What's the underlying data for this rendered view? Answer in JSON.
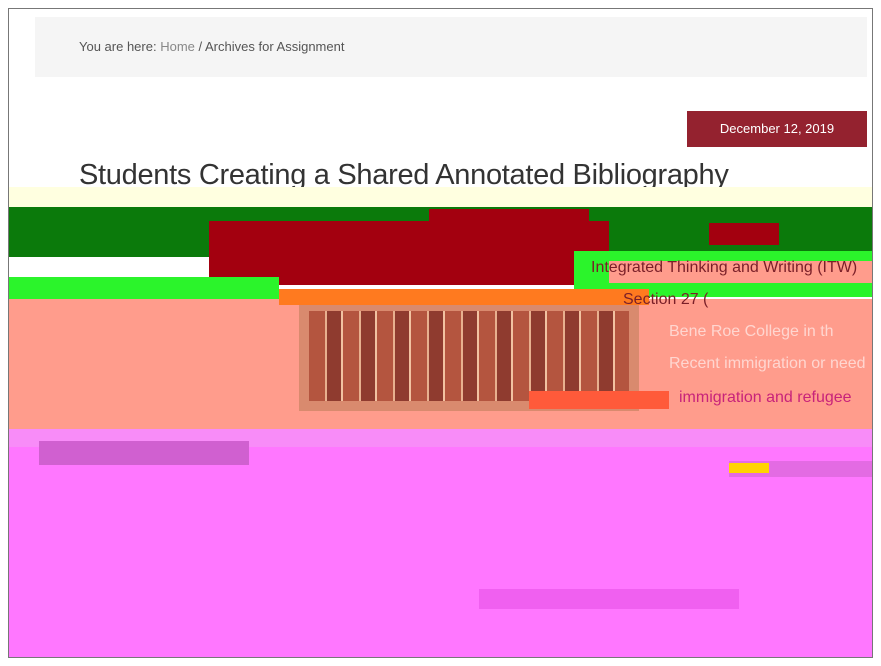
{
  "breadcrumb": {
    "prefix": "You are here: ",
    "home": "Home",
    "separator": " / ",
    "current": "Archives for Assignment"
  },
  "post": {
    "date": "December 12, 2019",
    "title": "Students Creating a Shared Annotated Bibliography",
    "summary_lines": [
      "Integrated Thinking and Writing (ITW)",
      "Section 27 (",
      "Bene Roe College in th",
      "Recent immigration or need",
      "immigration and refugee"
    ]
  },
  "colors": {
    "accent": "#94222f",
    "breadcrumb_bg": "#f5f5f5",
    "glitch_green": "#0b7a0b",
    "glitch_lime": "#2bf42b",
    "glitch_magenta": "#ff77ff",
    "glitch_salmon": "#ff9c8c"
  }
}
